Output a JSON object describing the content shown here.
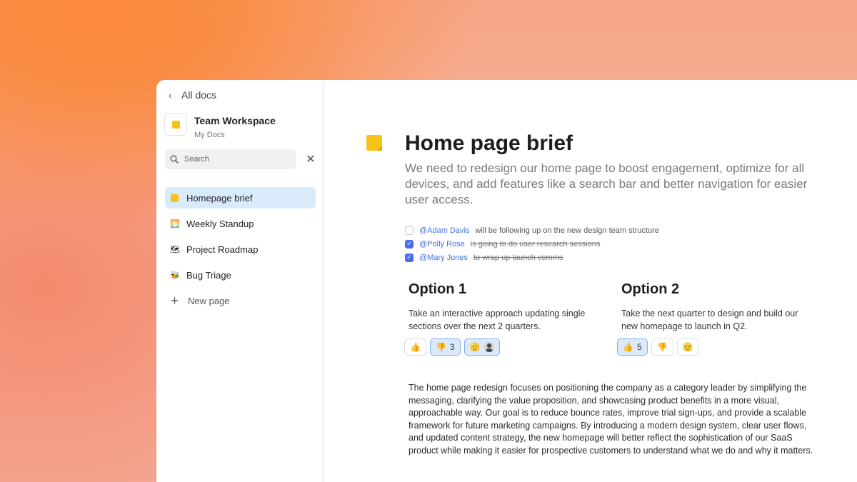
{
  "sidebar": {
    "back_label": "All docs",
    "workspace": {
      "title": "Team Workspace",
      "subtitle": "My Docs"
    },
    "search": {
      "placeholder": "Search",
      "value": ""
    },
    "items": [
      {
        "label": "Homepage brief",
        "icon": "sticky-note-icon",
        "active": true
      },
      {
        "label": "Weekly Standup",
        "icon": "sunrise-emoji-icon",
        "active": false
      },
      {
        "label": "Project Roadmap",
        "icon": "map-emoji-icon",
        "active": false
      },
      {
        "label": "Bug Triage",
        "icon": "bug-emoji-icon",
        "active": false
      }
    ],
    "new_page_label": "New page"
  },
  "doc": {
    "title": "Home page brief",
    "description": "We need to redesign our home page to boost engagement, optimize for all devices, and add features like a search bar and better navigation for easier user access.",
    "tasks": [
      {
        "mention": "@Adam Davis",
        "text": "will be following up on the new design team structure",
        "checked": false
      },
      {
        "mention": "@Polly Rose",
        "text": "is going to do user research sessions",
        "checked": true
      },
      {
        "mention": "@Mary Jones",
        "text": "to wrap up launch comms",
        "checked": true
      }
    ],
    "options": [
      {
        "title": "Option 1",
        "text": "Take an interactive approach updating single sections over the next 2 quarters.",
        "reactions": [
          {
            "emoji": "👍",
            "count": "",
            "selected": false
          },
          {
            "emoji": "👎",
            "count": "3",
            "selected": true
          },
          {
            "emoji": "🫡",
            "count": "",
            "selected": true
          }
        ]
      },
      {
        "title": "Option 2",
        "text": "Take the next quarter to design and build our new homepage to launch in Q2.",
        "reactions": [
          {
            "emoji": "👍",
            "count": "5",
            "selected": true
          },
          {
            "emoji": "👎",
            "count": "",
            "selected": false
          },
          {
            "emoji": "🫡",
            "count": "",
            "selected": false
          }
        ]
      }
    ],
    "body": "The home page redesign focuses on positioning the company as a category leader by simplifying the messaging, clarifying the value proposition, and showcasing product benefits in a more visual, approachable way. Our goal is to reduce bounce rates, improve trial sign-ups, and provide a scalable framework for future marketing campaigns. By introducing a modern design system, clear user flows, and updated content strategy, the new homepage will better reflect the sophistication of our SaaS product while making it easier for prospective customers to understand what we do and why it matters."
  },
  "colors": {
    "accent": "#4a6cf0",
    "mention": "#3f73d8",
    "active_nav": "#d9ebfb",
    "note_yellow": "#f7c21a"
  }
}
